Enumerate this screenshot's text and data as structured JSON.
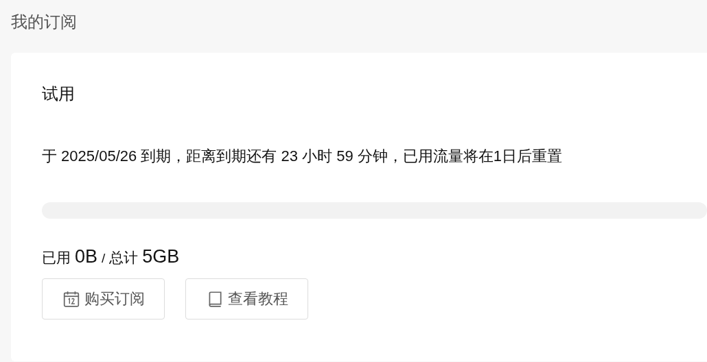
{
  "page": {
    "title": "我的订阅"
  },
  "subscription": {
    "plan": "试用",
    "expiry_text": "于 2025/05/26 到期，距离到期还有 23 小时 59 分钟，已用流量将在1日后重置",
    "usage": {
      "level": 0
    },
    "traffic": {
      "used_label": "已用",
      "used_value": "0B",
      "separator": "/",
      "total_label": "总计",
      "total_value": "5GB"
    },
    "buttons": [
      {
        "kind": "calendar",
        "label": "购买订阅"
      },
      {
        "kind": "book",
        "label": "查看教程"
      }
    ]
  }
}
